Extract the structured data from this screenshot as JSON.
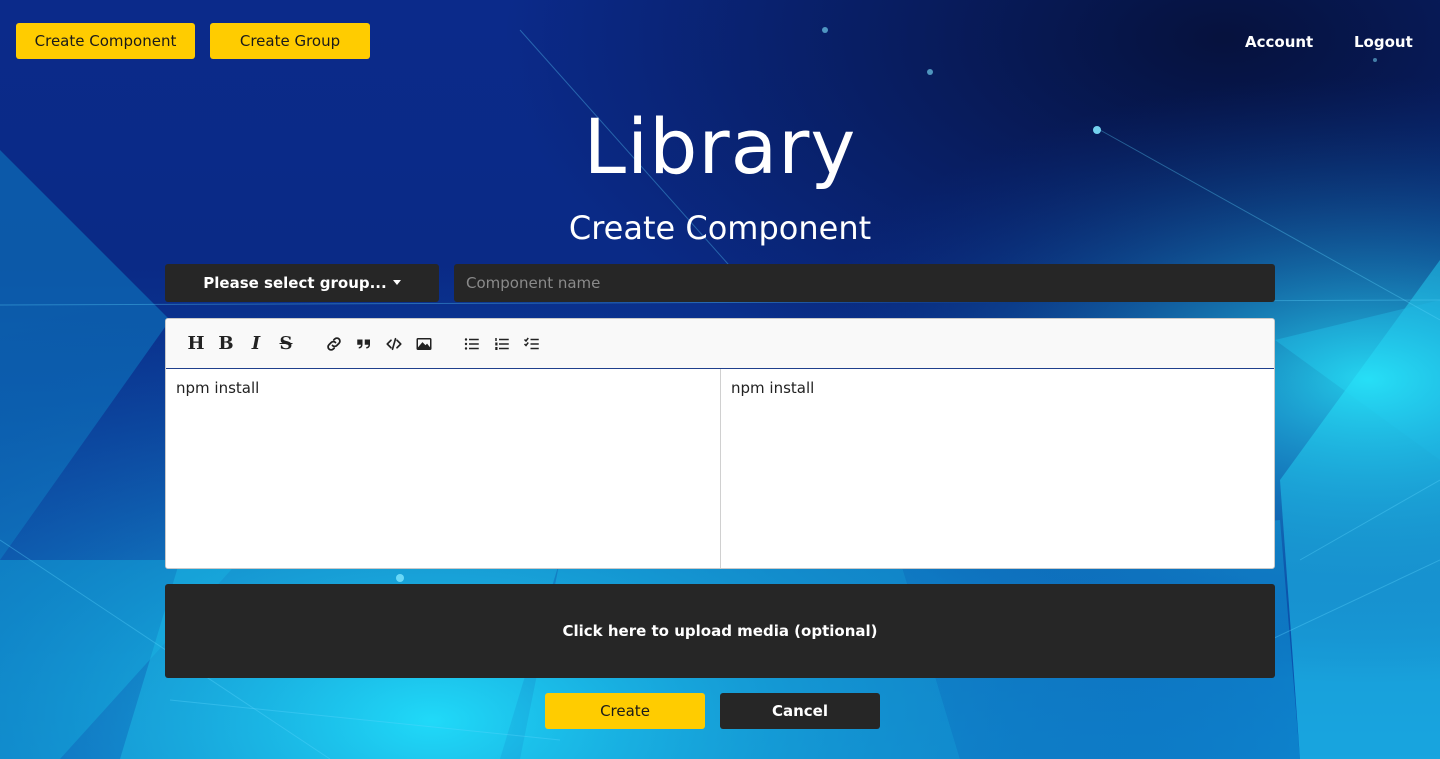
{
  "header": {
    "create_component_label": "Create Component",
    "create_group_label": "Create Group",
    "account_label": "Account",
    "logout_label": "Logout"
  },
  "main": {
    "title": "Library",
    "subtitle": "Create Component"
  },
  "form": {
    "group_dropdown_label": "Please select group...",
    "component_name_placeholder": "Component name",
    "component_name_value": ""
  },
  "editor": {
    "toolbar_icons": [
      "heading-icon",
      "bold-icon",
      "italic-icon",
      "strikethrough-icon",
      "link-icon",
      "quote-icon",
      "code-icon",
      "image-icon",
      "unordered-list-icon",
      "ordered-list-icon",
      "checklist-icon"
    ],
    "source_text": "npm install",
    "preview_text": "npm install"
  },
  "upload": {
    "label": "Click here to upload media (optional)"
  },
  "actions": {
    "create_label": "Create",
    "cancel_label": "Cancel"
  },
  "colors": {
    "accent": "#ffcc00",
    "dark_panel": "#262626",
    "background": "#07184a"
  }
}
